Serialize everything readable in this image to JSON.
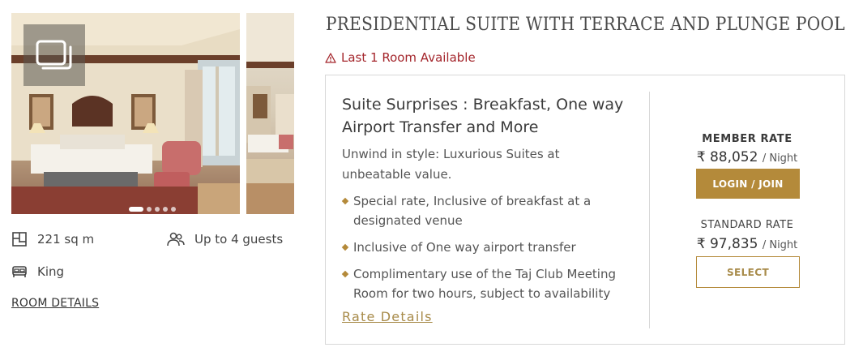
{
  "room": {
    "title": "PRESIDENTIAL SUITE WITH TERRACE AND PLUNGE POOL",
    "availability": "Last 1 Room Available",
    "gallery": {
      "button_icon": "gallery-icon",
      "slide_count": 5,
      "active_slide": 1
    },
    "amenities": {
      "area": "221 sq m",
      "guests": "Up to 4 guests",
      "bed": "King"
    },
    "details_link": "ROOM DETAILS"
  },
  "package": {
    "title": "Suite Surprises : Breakfast, One way Airport Transfer and More",
    "description": "Unwind in style: Luxurious Suites at unbeatable value.",
    "bullets": [
      "Special rate, Inclusive of breakfast at a designated venue",
      "Inclusive of One way airport transfer",
      "Complimentary use of the Taj Club Meeting Room for two hours, subject to availability"
    ],
    "rate_details_link": "Rate Details"
  },
  "rates": {
    "member": {
      "label": "MEMBER RATE",
      "price": "₹ 88,052",
      "per": "/ Night",
      "button": "LOGIN / JOIN"
    },
    "standard": {
      "label": "STANDARD RATE",
      "price": "₹ 97,835",
      "per": "/ Night",
      "button": "SELECT"
    }
  },
  "colors": {
    "accent_gold": "#b48a3a",
    "alert_red": "#a4262c",
    "border": "#d8d8d8"
  }
}
